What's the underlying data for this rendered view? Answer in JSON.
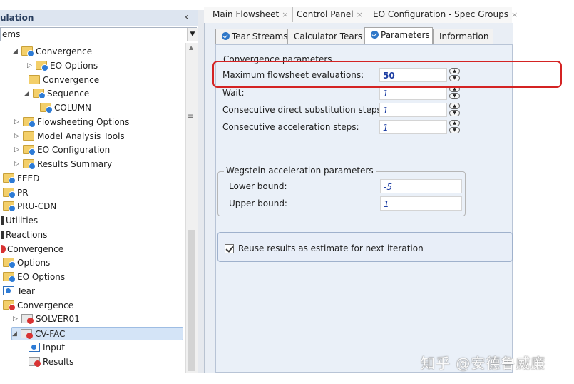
{
  "nav": {
    "title": "ulation",
    "combo_value": "ems",
    "collapse_glyph": "‹",
    "tree": [
      {
        "label": "Convergence",
        "icon": "folder-check-icon",
        "arrow": "◢"
      },
      {
        "label": "EO Options",
        "icon": "folder-check-icon",
        "arrow": "▷"
      },
      {
        "label": "Convergence",
        "icon": "folder-icon",
        "arrow": ""
      },
      {
        "label": "Sequence",
        "icon": "folder-check-icon",
        "arrow": "◢"
      },
      {
        "label": "COLUMN",
        "icon": "folder-check-icon",
        "arrow": ""
      },
      {
        "label": "Flowsheeting Options",
        "icon": "folder-check-icon",
        "arrow": "▷"
      },
      {
        "label": "Model Analysis Tools",
        "icon": "folder-icon",
        "arrow": "▷"
      },
      {
        "label": "EO Configuration",
        "icon": "folder-check-icon",
        "arrow": "▷"
      },
      {
        "label": "Results Summary",
        "icon": "folder-check-icon",
        "arrow": "▷"
      },
      {
        "label": "FEED",
        "icon": "folder-check-icon",
        "arrow": ""
      },
      {
        "label": "PR",
        "icon": "folder-check-icon",
        "arrow": ""
      },
      {
        "label": "PRU-CDN",
        "icon": "folder-check-icon",
        "arrow": ""
      },
      {
        "label": "Utilities",
        "icon": "bar-icon",
        "arrow": ""
      },
      {
        "label": "Reactions",
        "icon": "bar-icon",
        "arrow": ""
      },
      {
        "label": "Convergence",
        "icon": "convergence-error-icon",
        "arrow": ""
      },
      {
        "label": "Options",
        "icon": "folder-check-icon",
        "arrow": ""
      },
      {
        "label": "EO Options",
        "icon": "folder-check-icon",
        "arrow": ""
      },
      {
        "label": "Tear",
        "icon": "document-check-icon",
        "arrow": ""
      },
      {
        "label": "Convergence",
        "icon": "folder-error-icon",
        "arrow": ""
      },
      {
        "label": "SOLVER01",
        "icon": "error-icon",
        "arrow": "▷"
      },
      {
        "label": "CV-FAC",
        "icon": "error-icon",
        "arrow": "◢"
      },
      {
        "label": "Input",
        "icon": "document-check-icon",
        "arrow": ""
      },
      {
        "label": "Results",
        "icon": "error-icon",
        "arrow": ""
      }
    ]
  },
  "doc_tabs": [
    {
      "label": "Main Flowsheet",
      "close": "×"
    },
    {
      "label": "Control Panel",
      "close": "×"
    },
    {
      "label": "EO Configuration - Spec Groups",
      "close": "×"
    }
  ],
  "form_tabs": [
    {
      "label": "Tear Streams",
      "icon": "check-circle-icon"
    },
    {
      "label": "Calculator Tears",
      "icon": ""
    },
    {
      "label": "Parameters",
      "icon": "check-circle-icon"
    },
    {
      "label": "Information",
      "icon": ""
    }
  ],
  "parameters": {
    "group_convergence": "Convergence parameters",
    "max_evals_label": "Maximum flowsheet evaluations:",
    "max_evals_value": "50",
    "wait_label": "Wait:",
    "wait_value": "1",
    "direct_sub_label": "Consecutive direct substitution steps:",
    "direct_sub_value": "1",
    "accel_label": "Consecutive acceleration steps:",
    "accel_value": "1",
    "group_wegstein": "Wegstein acceleration parameters",
    "lower_label": "Lower bound:",
    "lower_value": "-5",
    "upper_label": "Upper bound:",
    "upper_value": "1",
    "reuse_label": "Reuse results as estimate for next iteration",
    "reuse_checked": true
  },
  "spin_up": "▲",
  "spin_down": "▼",
  "watermark": "知乎 @安德鲁威廉",
  "colors": {
    "highlight": "#d42323",
    "accent": "#2d7bd6",
    "value_text": "#1f3fa3"
  }
}
